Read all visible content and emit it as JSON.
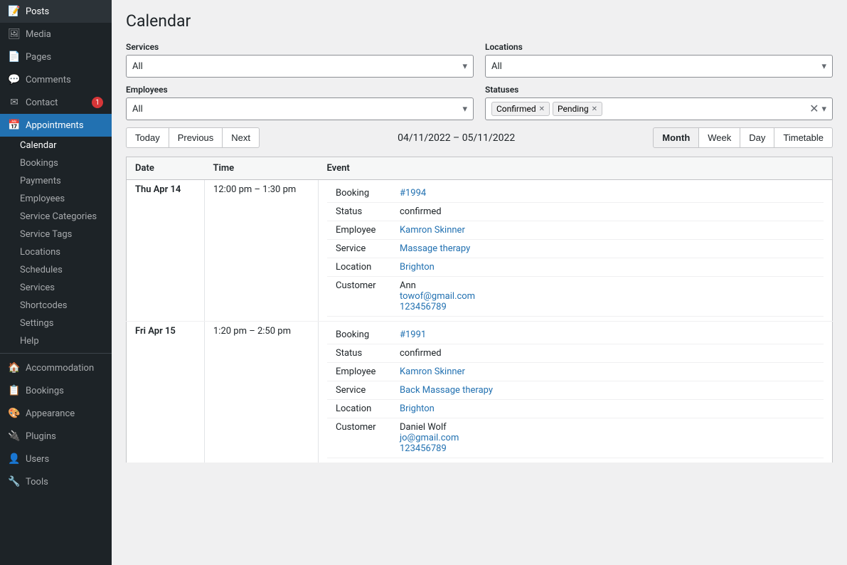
{
  "sidebar": {
    "items": [
      {
        "id": "posts",
        "label": "Posts",
        "icon": "📝",
        "badge": null
      },
      {
        "id": "media",
        "label": "Media",
        "icon": "🖼",
        "badge": null
      },
      {
        "id": "pages",
        "label": "Pages",
        "icon": "📄",
        "badge": null
      },
      {
        "id": "comments",
        "label": "Comments",
        "icon": "💬",
        "badge": null
      },
      {
        "id": "contact",
        "label": "Contact",
        "icon": "✉",
        "badge": "1"
      },
      {
        "id": "appointments",
        "label": "Appointments",
        "icon": "📅",
        "badge": null
      }
    ],
    "appointments_sub": [
      {
        "id": "calendar",
        "label": "Calendar",
        "active": true
      },
      {
        "id": "bookings",
        "label": "Bookings"
      },
      {
        "id": "payments",
        "label": "Payments"
      },
      {
        "id": "employees",
        "label": "Employees"
      },
      {
        "id": "service-categories",
        "label": "Service Categories"
      },
      {
        "id": "service-tags",
        "label": "Service Tags"
      },
      {
        "id": "locations",
        "label": "Locations"
      },
      {
        "id": "schedules",
        "label": "Schedules"
      },
      {
        "id": "services",
        "label": "Services"
      },
      {
        "id": "shortcodes",
        "label": "Shortcodes"
      },
      {
        "id": "settings",
        "label": "Settings"
      },
      {
        "id": "help",
        "label": "Help"
      }
    ],
    "bottom_items": [
      {
        "id": "accommodation",
        "label": "Accommodation",
        "icon": "🏠"
      },
      {
        "id": "bookings2",
        "label": "Bookings",
        "icon": "📋"
      },
      {
        "id": "appearance",
        "label": "Appearance",
        "icon": "🎨"
      },
      {
        "id": "plugins",
        "label": "Plugins",
        "icon": "🔌"
      },
      {
        "id": "users",
        "label": "Users",
        "icon": "👤"
      },
      {
        "id": "tools",
        "label": "Tools",
        "icon": "🔧"
      }
    ]
  },
  "page_title": "Calendar",
  "filters": {
    "services_label": "Services",
    "services_placeholder": "All",
    "locations_label": "Locations",
    "locations_placeholder": "All",
    "employees_label": "Employees",
    "employees_placeholder": "All",
    "statuses_label": "Statuses",
    "status_tags": [
      {
        "label": "Confirmed"
      },
      {
        "label": "Pending"
      }
    ]
  },
  "calendar_nav": {
    "today_label": "Today",
    "previous_label": "Previous",
    "next_label": "Next",
    "date_range": "04/11/2022 – 05/11/2022",
    "views": [
      {
        "id": "month",
        "label": "Month",
        "active": true
      },
      {
        "id": "week",
        "label": "Week",
        "active": false
      },
      {
        "id": "day",
        "label": "Day",
        "active": false
      },
      {
        "id": "timetable",
        "label": "Timetable",
        "active": false
      }
    ]
  },
  "table": {
    "headers": [
      "Date",
      "Time",
      "Event"
    ],
    "rows": [
      {
        "date": "Thu Apr 14",
        "time": "12:00 pm – 1:30 pm",
        "booking_id": "#1994",
        "booking_link": "#",
        "status": "confirmed",
        "employee": "Kamron Skinner",
        "employee_link": "#",
        "service": "Massage therapy",
        "service_link": "#",
        "location": "Brighton",
        "location_link": "#",
        "customer_name": "Ann",
        "customer_email": "towof@gmail.com",
        "customer_email_link": "#",
        "customer_phone": "123456789"
      },
      {
        "date": "Fri Apr 15",
        "time": "1:20 pm – 2:50 pm",
        "booking_id": "#1991",
        "booking_link": "#",
        "status": "confirmed",
        "employee": "Kamron Skinner",
        "employee_link": "#",
        "service": "Back Massage therapy",
        "service_link": "#",
        "location": "Brighton",
        "location_link": "#",
        "customer_name": "Daniel Wolf",
        "customer_email": "jo@gmail.com",
        "customer_email_link": "#",
        "customer_phone": "123456789"
      }
    ],
    "booking_label": "Booking",
    "status_label": "Status",
    "employee_label": "Employee",
    "service_label": "Service",
    "location_label": "Location",
    "customer_label": "Customer"
  }
}
